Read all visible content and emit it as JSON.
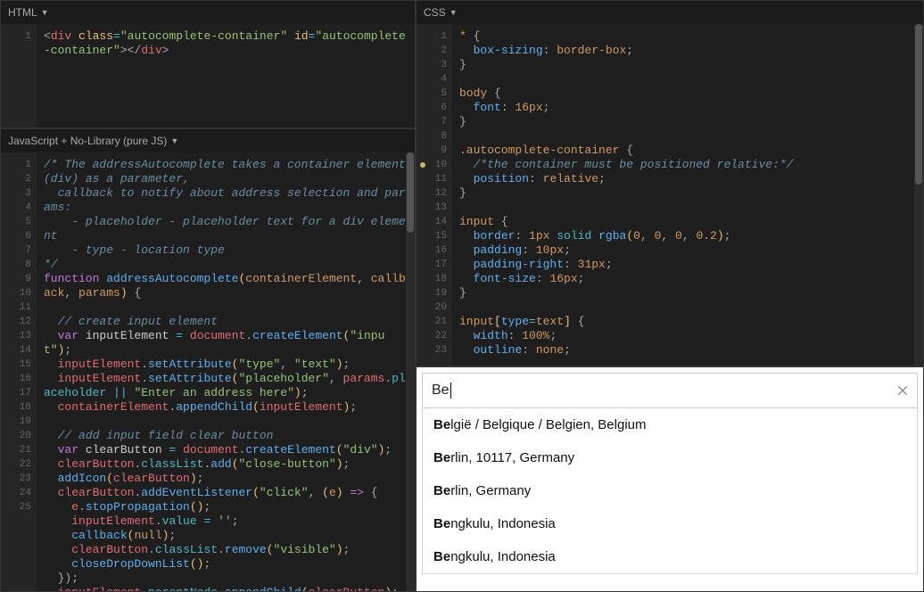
{
  "panels": {
    "html": {
      "title": "HTML"
    },
    "css": {
      "title": "CSS"
    },
    "js": {
      "title": "JavaScript + No-Library (pure JS)"
    }
  },
  "html_code": {
    "tag_open": "div",
    "attr_class": "class",
    "attr_class_val": "autocomplete-container",
    "attr_id": "id",
    "attr_id_val": "autocomplete-container",
    "tag_close": "div"
  },
  "css_code": {
    "lines": [
      {
        "n": 1,
        "sel": "*",
        "open": " {"
      },
      {
        "n": 2,
        "prop": "box-sizing",
        "val": "border-box",
        "semi": ";"
      },
      {
        "n": 3,
        "close": "}"
      },
      {
        "n": 4,
        "blank": true
      },
      {
        "n": 5,
        "sel": "body",
        "open": " {"
      },
      {
        "n": 6,
        "prop": "font",
        "val": "16px",
        "semi": ";"
      },
      {
        "n": 7,
        "close": "}"
      },
      {
        "n": 8,
        "blank": true
      },
      {
        "n": 9,
        "sel": ".autocomplete-container",
        "open": " {"
      },
      {
        "n": 10,
        "comment": "/*the container must be positioned relative:*/",
        "dot": true
      },
      {
        "n": 11,
        "prop": "position",
        "val": "relative",
        "semi": ";"
      },
      {
        "n": 12,
        "close": "}"
      },
      {
        "n": 13,
        "blank": true
      },
      {
        "n": 14,
        "sel": "input",
        "open": " {"
      },
      {
        "n": 15,
        "prop": "border",
        "val_raw": "1px solid rgba(0, 0, 0, 0.2)",
        "semi": ";"
      },
      {
        "n": 16,
        "prop": "padding",
        "val": "10px",
        "semi": ";"
      },
      {
        "n": 17,
        "prop": "padding-right",
        "val": "31px",
        "semi": ";"
      },
      {
        "n": 18,
        "prop": "font-size",
        "val": "16px",
        "semi": ";"
      },
      {
        "n": 19,
        "close": "}"
      },
      {
        "n": 20,
        "blank": true
      },
      {
        "n": 21,
        "sel_raw": "input[type=text]",
        "open": " {"
      },
      {
        "n": 22,
        "prop": "width",
        "val": "100%",
        "semi": ";"
      },
      {
        "n": 23,
        "prop": "outline",
        "val": "none",
        "semi": ";",
        "clipped": true
      }
    ]
  },
  "js_code": {
    "lines": [
      {
        "n": 1,
        "raw": "comment",
        "text": "/* The addressAutocomplete takes a container element (div) as a parameter,"
      },
      {
        "n": 2,
        "raw": "comment",
        "text": "  callback to notify about address selection and params:"
      },
      {
        "n": 3,
        "raw": "comment",
        "text": "    - placeholder - placeholder text for a div element"
      },
      {
        "n": 4,
        "raw": "comment",
        "text": "    - type - location type"
      },
      {
        "n": 5,
        "raw": "comment",
        "text": "*/"
      },
      {
        "n": 6,
        "raw": "fnsig"
      },
      {
        "n": 7,
        "raw": "blank"
      },
      {
        "n": 8,
        "raw": "comment2",
        "text": "  // create input element"
      },
      {
        "n": 9,
        "raw": "l9"
      },
      {
        "n": 10,
        "raw": "l10"
      },
      {
        "n": 11,
        "raw": "l11"
      },
      {
        "n": 12,
        "raw": "l12"
      },
      {
        "n": 13,
        "raw": "blank"
      },
      {
        "n": 14,
        "raw": "comment2",
        "text": "  // add input field clear button"
      },
      {
        "n": 15,
        "raw": "l15"
      },
      {
        "n": 16,
        "raw": "l16"
      },
      {
        "n": 17,
        "raw": "l17"
      },
      {
        "n": 18,
        "raw": "l18"
      },
      {
        "n": 19,
        "raw": "l19"
      },
      {
        "n": 20,
        "raw": "l20"
      },
      {
        "n": 21,
        "raw": "l21"
      },
      {
        "n": 22,
        "raw": "l22"
      },
      {
        "n": 23,
        "raw": "l23"
      },
      {
        "n": 24,
        "raw": "l24"
      },
      {
        "n": 25,
        "raw": "l25"
      }
    ],
    "fnsig": {
      "kw": "function",
      "name": "addressAutocomplete",
      "p1": "containerElement",
      "p2": "callback",
      "p3": "params"
    },
    "l9": {
      "kw": "var",
      "name": "inputElement",
      "eq": "=",
      "obj": "document",
      "dot": ".",
      "fn": "createElement",
      "str": "\"input\"",
      "end": ";"
    },
    "l10": {
      "obj": "inputElement",
      "fn": "setAttribute",
      "s1": "\"type\"",
      "s2": "\"text\"",
      "end": ";"
    },
    "l11": {
      "obj": "inputElement",
      "fn": "setAttribute",
      "s1": "\"placeholder\"",
      "obj2": "params",
      "prop2": "placeholder",
      "or": "||",
      "s2": "\"Enter an address here\"",
      "end": ";"
    },
    "l12": {
      "obj": "containerElement",
      "fn": "appendChild",
      "arg": "inputElement",
      "end": ";"
    },
    "l15": {
      "kw": "var",
      "name": "clearButton",
      "eq": "=",
      "obj": "document",
      "fn": "createElement",
      "str": "\"div\"",
      "end": ";"
    },
    "l16": {
      "obj": "clearButton",
      "prop": "classList",
      "fn": "add",
      "str": "\"close-button\"",
      "end": ";"
    },
    "l17": {
      "fn": "addIcon",
      "arg": "clearButton",
      "end": ";"
    },
    "l18": {
      "obj": "clearButton",
      "fn": "addEventListener",
      "s1": "\"click\"",
      "p": "e",
      "arrow": "=>",
      "open": "{"
    },
    "l19": {
      "obj": "e",
      "fn": "stopPropagation",
      "end": "();"
    },
    "l20": {
      "obj": "inputElement",
      "prop": "value",
      "eq": "=",
      "str": "''",
      "end": ";"
    },
    "l21": {
      "fn": "callback",
      "arg": "null",
      "end": ";"
    },
    "l22": {
      "obj": "clearButton",
      "prop": "classList",
      "fn": "remove",
      "str": "\"visible\"",
      "end": ";"
    },
    "l23": {
      "fn": "closeDropDownList",
      "end": "();"
    },
    "l24": {
      "close": "});"
    },
    "l25": {
      "obj": "inputElement",
      "prop": "parentNode",
      "fn": "appendChild",
      "arg": "clearButton",
      "end": ";"
    }
  },
  "result": {
    "input_value": "Be",
    "suggestions": [
      {
        "match": "Be",
        "rest": "lgië / Belgique / Belgien, Belgium"
      },
      {
        "match": "Be",
        "rest": "rlin, 10117, Germany"
      },
      {
        "match": "Be",
        "rest": "rlin, Germany"
      },
      {
        "match": "Be",
        "rest": "ngkulu, Indonesia"
      },
      {
        "match": "Be",
        "rest": "ngkulu, Indonesia"
      }
    ]
  }
}
